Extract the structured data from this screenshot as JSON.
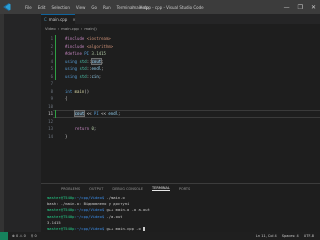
{
  "titlebar": {
    "menu": [
      "File",
      "Edit",
      "Selection",
      "View",
      "Go",
      "Run",
      "Terminal",
      "Help"
    ],
    "title": "main.cpp - cpp - Visual Studio Code",
    "controls": [
      "—",
      "❐",
      "✕"
    ]
  },
  "tab": {
    "label": "main.cpp",
    "close": "×"
  },
  "breadcrumbs": [
    "Video",
    "main.cpp",
    "main()"
  ],
  "editor": {
    "line_numbers": [
      "1",
      "2",
      "3",
      "4",
      "5",
      "6",
      "7",
      "8",
      "9",
      "10",
      "11",
      "12",
      "13",
      "14"
    ],
    "current_line": "11",
    "lines": [
      [
        {
          "c": "kw-inc",
          "t": "#include "
        },
        {
          "c": "hdr",
          "t": "<iostream>"
        }
      ],
      [
        {
          "c": "kw-inc",
          "t": "#include "
        },
        {
          "c": "hdr",
          "t": "<algorithm>"
        }
      ],
      [
        {
          "c": "kw-def",
          "t": "#define "
        },
        {
          "c": "mac",
          "t": "PI "
        },
        {
          "c": "num",
          "t": "3.1415"
        }
      ],
      [
        {
          "c": "kw",
          "t": "using "
        },
        {
          "c": "ns",
          "t": "std"
        },
        {
          "c": "",
          "t": "::"
        },
        {
          "c": "id hl",
          "t": "cout"
        },
        {
          "c": "",
          "t": ";"
        }
      ],
      [
        {
          "c": "kw",
          "t": "using "
        },
        {
          "c": "ns",
          "t": "std"
        },
        {
          "c": "",
          "t": "::"
        },
        {
          "c": "id",
          "t": "endl"
        },
        {
          "c": "",
          "t": ";"
        }
      ],
      [
        {
          "c": "kw",
          "t": "using "
        },
        {
          "c": "ns",
          "t": "std"
        },
        {
          "c": "",
          "t": "::"
        },
        {
          "c": "id",
          "t": "cin"
        },
        {
          "c": "",
          "t": ";"
        }
      ],
      [
        {
          "c": "",
          "t": ""
        }
      ],
      [
        {
          "c": "kw",
          "t": "int "
        },
        {
          "c": "fn",
          "t": "main"
        },
        {
          "c": "",
          "t": "()"
        }
      ],
      [
        {
          "c": "",
          "t": "{"
        }
      ],
      [
        {
          "c": "",
          "t": ""
        }
      ],
      [
        {
          "c": "",
          "t": "    "
        },
        {
          "c": "id hl",
          "t": "cout"
        },
        {
          "c": "",
          "t": " << "
        },
        {
          "c": "mac",
          "t": "PI"
        },
        {
          "c": "",
          "t": " << "
        },
        {
          "c": "id",
          "t": "endl"
        },
        {
          "c": "",
          "t": ";"
        }
      ],
      [
        {
          "c": "",
          "t": ""
        }
      ],
      [
        {
          "c": "",
          "t": "    "
        },
        {
          "c": "ctl",
          "t": "return "
        },
        {
          "c": "num",
          "t": "0"
        },
        {
          "c": "",
          "t": ";"
        }
      ],
      [
        {
          "c": "",
          "t": "}"
        }
      ]
    ]
  },
  "panel": {
    "tabs": [
      "PROBLEMS",
      "OUTPUT",
      "DEBUG CONSOLE",
      "TERMINAL",
      "PORTS"
    ],
    "active_tab": "TERMINAL",
    "terminal": [
      {
        "user": "master@T540p",
        "path": ":~/cpp/Video$",
        "cmd": " ./main.o"
      },
      {
        "user": "",
        "path": "",
        "cmd": "bash: ./main.o: Відмовлено у доступі"
      },
      {
        "user": "master@T540p",
        "path": ":~/cpp/Video$",
        "cmd": " g++ main.o -o a.out"
      },
      {
        "user": "master@T540p",
        "path": ":~/cpp/Video$",
        "cmd": " ./a.out"
      },
      {
        "user": "",
        "path": "",
        "cmd": "3.1415"
      },
      {
        "user": "master@T540p",
        "path": ":~/cpp/Video$",
        "cmd": " g++ main.cpp -o "
      }
    ]
  },
  "statusbar": {
    "left": [
      "⊗ 0  ⚠ 0",
      "⚲ 0"
    ],
    "right": [
      "Ln 11, Col 4",
      "Spaces: 4",
      "UTF-8"
    ]
  }
}
